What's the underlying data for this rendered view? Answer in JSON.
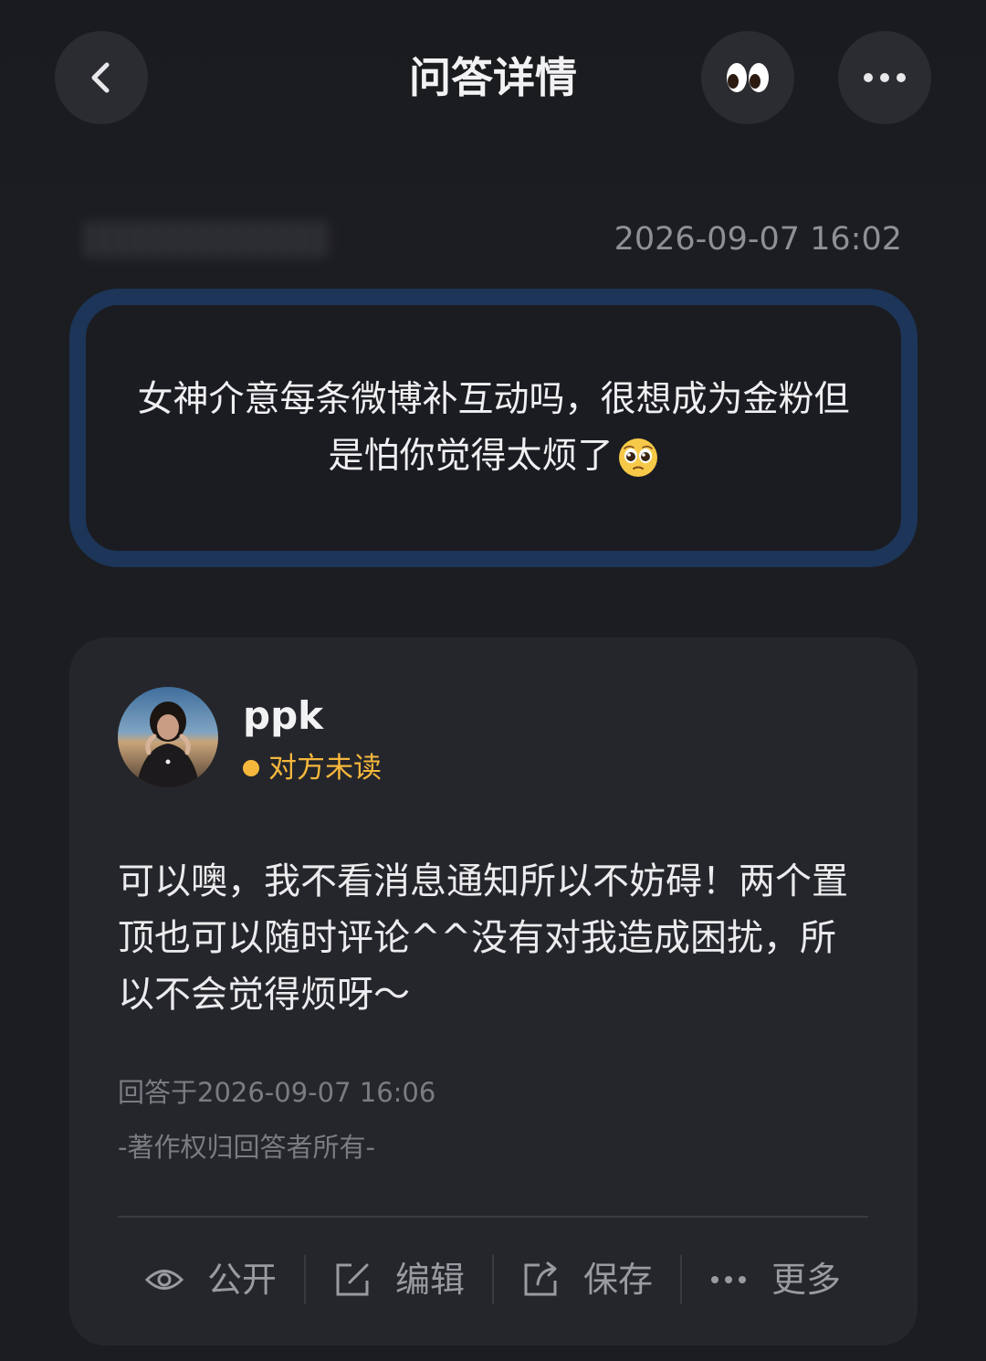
{
  "header": {
    "title": "问答详情",
    "back_icon": "chevron-left-icon",
    "eyes_icon": "eyes-emoji-icon",
    "more_icon": "more-dots-icon"
  },
  "question": {
    "timestamp": "2026-09-07 16:02",
    "text": "女神介意每条微博补互动吗，很想成为金粉但是怕你觉得太烦了",
    "emoji": "pleading-face-icon",
    "border_color": "#1c3558"
  },
  "answer": {
    "name": "ppk",
    "status": "对方未读",
    "status_color": "#f5b73c",
    "text": "可以噢，我不看消息通知所以不妨碍！两个置顶也可以随时评论^^没有对我造成困扰，所以不会觉得烦呀～",
    "answered_at": "回答于2026-09-07 16:06",
    "copyright": "-著作权归回答者所有-"
  },
  "actions": [
    {
      "label": "公开",
      "icon": "eye-icon"
    },
    {
      "label": "编辑",
      "icon": "edit-icon"
    },
    {
      "label": "保存",
      "icon": "share-icon"
    },
    {
      "label": "更多",
      "icon": "more-dots-icon"
    }
  ]
}
